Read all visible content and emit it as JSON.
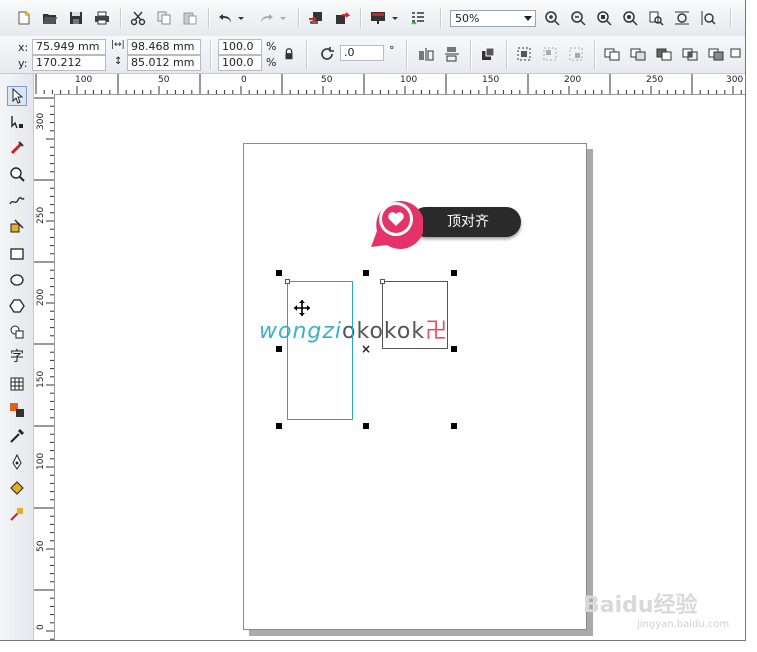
{
  "toolbar": {
    "zoom_value": "50%",
    "icons": [
      "new-icon",
      "open-icon",
      "save-icon",
      "print-icon",
      "cut-icon",
      "copy-icon",
      "paste-icon",
      "undo-icon",
      "redo-icon",
      "import-icon",
      "export-icon",
      "launcher-icon",
      "options-icon",
      "zoom-in-icon",
      "zoom-out-icon",
      "zoom-selected-icon",
      "zoom-all-icon",
      "zoom-page-icon",
      "zoom-width-icon",
      "zoom-height-icon"
    ]
  },
  "property_bar": {
    "x_label": "x:",
    "x_value": "75.949 mm",
    "y_label": "y:",
    "y_value": "170.212 mm",
    "width_value": "98.468 mm",
    "height_value": "85.012 mm",
    "scale_w": "100.0",
    "scale_h": "100.0",
    "percent1": "%",
    "percent2": "%",
    "rotation_value": ".0",
    "degree": "°"
  },
  "ruler": {
    "h_labels": [
      "100",
      "50",
      "0",
      "50",
      "100",
      "150",
      "200",
      "250",
      "300"
    ],
    "v_labels": [
      "300",
      "250",
      "200",
      "150",
      "100",
      "50",
      "0"
    ]
  },
  "canvas": {
    "callout_text": "顶对齐",
    "watermark_part1": "wongzi",
    "watermark_part2": "okokok",
    "watermark_seal": "卍",
    "baidu_logo": "Baidu经验",
    "baidu_url": "jingyan.baidu.com"
  },
  "colors": {
    "accent_pink": "#e5336a",
    "teal": "#2aa7c4",
    "callout_bg": "#2a2a2a"
  }
}
